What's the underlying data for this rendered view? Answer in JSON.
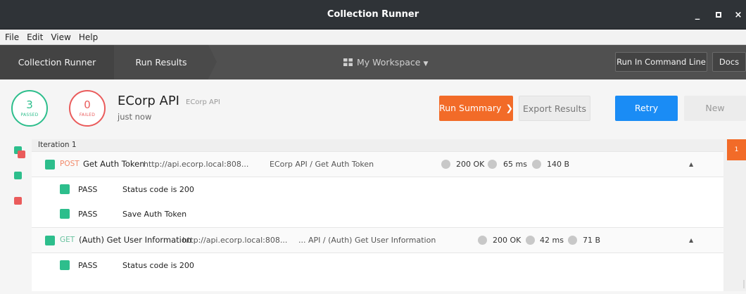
{
  "window": {
    "title": "Collection Runner",
    "minimize": "_",
    "close": "×"
  },
  "menu": [
    "File",
    "Edit",
    "View",
    "Help"
  ],
  "nav": {
    "tabs": [
      "Collection Runner",
      "Run Results"
    ],
    "workspace": "My Workspace",
    "run_in_command_line": "Run In Command Line",
    "docs": "Docs"
  },
  "summary": {
    "passed_count": "3",
    "passed_label": "PASSED",
    "failed_count": "0",
    "failed_label": "FAILED",
    "collection_name": "ECorp API",
    "collection_sub": "ECorp API",
    "time": "just now",
    "run_summary": "Run Summary",
    "export_results": "Export Results",
    "retry": "Retry",
    "new": "New"
  },
  "results": {
    "iteration": "Iteration 1",
    "requests": [
      {
        "method": "POST",
        "name": "Get Auth Token",
        "url": "http://api.ecorp.local:808...",
        "path": "ECorp API / Get Auth Token",
        "status": "200 OK",
        "time": "65 ms",
        "size": "140 B",
        "tests": [
          {
            "status": "PASS",
            "name": "Status code is 200"
          },
          {
            "status": "PASS",
            "name": "Save Auth Token"
          }
        ]
      },
      {
        "method": "GET",
        "name": "(Auth) Get User Information",
        "url": "http://api.ecorp.local:808...",
        "path": "... API / (Auth) Get User Information",
        "status": "200 OK",
        "time": "42 ms",
        "size": "71 B",
        "tests": [
          {
            "status": "PASS",
            "name": "Status code is 200"
          }
        ]
      }
    ]
  },
  "right_rail": {
    "iteration_flag": "1"
  },
  "colors": {
    "pass": "#2dbe8c",
    "fail": "#ea5b5b",
    "accent_orange": "#f26b28",
    "accent_blue": "#1a8cf5"
  }
}
